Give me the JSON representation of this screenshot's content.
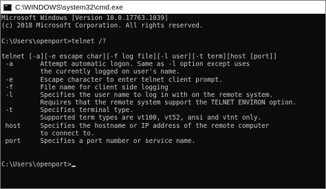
{
  "window": {
    "title": "C:\\WINDOWS\\system32\\cmd.exe",
    "icon": "cmd-console-icon"
  },
  "console": {
    "lines": [
      "Microsoft Windows [Version 10.0.17763.1039]",
      "(c) 2018 Microsoft Corporation. All rights reserved.",
      "",
      "C:\\Users\\openport>telnet /?",
      "",
      "telnet [-a][-e escape char][-f log file][-l user][-t term][host [port]]",
      " -a       Attempt automatic logon. Same as -l option except uses",
      "          the currently logged on user's name.",
      " -e       Escape character to enter telnet client prompt.",
      " -f       File name for client side logging",
      " -l       Specifies the user name to log in with on the remote system.",
      "          Requires that the remote system support the TELNET ENVIRON option.",
      " -t       Specifies terminal type.",
      "          Supported term types are vt100, vt52, ansi and vtnt only.",
      " host     Specifies the hostname or IP address of the remote computer",
      "          to connect to.",
      " port     Specifies a port number or service name.",
      "",
      "",
      "C:\\Users\\openport>"
    ]
  },
  "colors": {
    "console_background": "#0c0c0c",
    "console_text": "#cccccc",
    "titlebar_background": "#ffffff"
  }
}
